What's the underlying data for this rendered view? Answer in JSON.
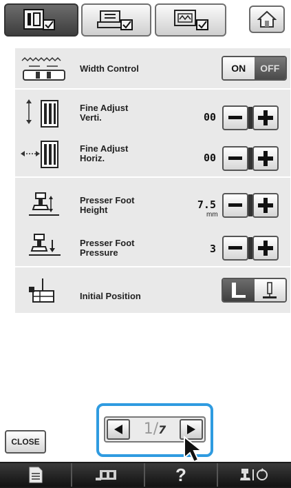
{
  "tabs": [
    {
      "icon": "utility-settings-icon",
      "active": true
    },
    {
      "icon": "general-settings-icon",
      "active": false
    },
    {
      "icon": "embroidery-settings-icon",
      "active": false
    }
  ],
  "home": {
    "icon": "home-icon"
  },
  "settings": {
    "width_control": {
      "label": "Width Control",
      "on_label": "ON",
      "off_label": "OFF",
      "state": "OFF"
    },
    "fine_adjust_verti": {
      "label": "Fine Adjust\nVerti.",
      "value": "00"
    },
    "fine_adjust_horiz": {
      "label": "Fine Adjust\nHoriz.",
      "value": "00"
    },
    "presser_foot_height": {
      "label": "Presser Foot\nHeight",
      "value": "7.5",
      "unit": "mm"
    },
    "presser_foot_pressure": {
      "label": "Presser Foot\nPressure",
      "value": "3"
    },
    "initial_position": {
      "label": "Initial Position"
    }
  },
  "pager": {
    "current": "1",
    "total": "7"
  },
  "close_label": "CLOSE",
  "bottom_bar": {
    "help_glyph": "?"
  },
  "colors": {
    "highlight": "#2f9be0",
    "panel": "#e9e9e9",
    "bar": "#1b1b1b"
  }
}
